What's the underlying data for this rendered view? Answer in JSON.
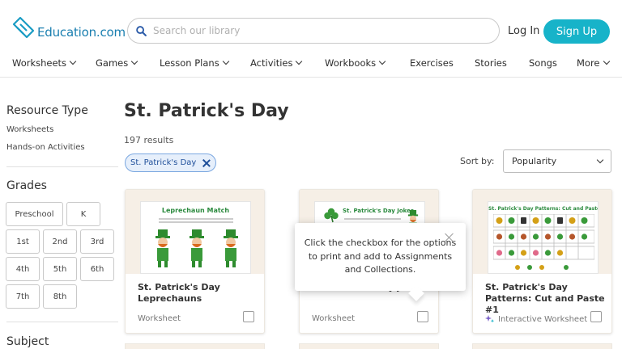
{
  "brand": {
    "name": "Education.com"
  },
  "search": {
    "placeholder": "Search our library"
  },
  "auth": {
    "login": "Log In",
    "signup": "Sign Up"
  },
  "nav": [
    {
      "label": "Worksheets",
      "dropdown": true
    },
    {
      "label": "Games",
      "dropdown": true
    },
    {
      "label": "Lesson Plans",
      "dropdown": true
    },
    {
      "label": "Activities",
      "dropdown": true
    },
    {
      "label": "Workbooks",
      "dropdown": true
    },
    {
      "label": "Exercises",
      "dropdown": false
    },
    {
      "label": "Stories",
      "dropdown": false
    },
    {
      "label": "Songs",
      "dropdown": false
    },
    {
      "label": "More",
      "dropdown": true
    }
  ],
  "sidebar": {
    "resource_type": {
      "heading": "Resource Type",
      "items": [
        "Worksheets",
        "Hands-on Activities"
      ]
    },
    "grades": {
      "heading": "Grades",
      "items": [
        "Preschool",
        "K",
        "1st",
        "2nd",
        "3rd",
        "4th",
        "5th",
        "6th",
        "7th",
        "8th"
      ]
    },
    "subject": {
      "heading": "Subject"
    }
  },
  "main": {
    "title": "St. Patrick's Day",
    "results": "197 results",
    "filter_chip": "St. Patrick's Day",
    "sort": {
      "label": "Sort by:",
      "value": "Popularity"
    }
  },
  "cards": [
    {
      "title": "St. Patrick's Day Leprechauns",
      "type": "Worksheet",
      "thumb_heading": "Leprechaun Match"
    },
    {
      "title": "St. Patrick's Day Jokes",
      "type": "Worksheet",
      "thumb_heading": "St. Patrick's Day Jokes"
    },
    {
      "title": "St. Patrick's Day Patterns: Cut and Paste #1",
      "type": "Interactive Worksheet",
      "thumb_heading": "St. Patrick's Day Patterns: Cut and Paste #1"
    }
  ],
  "tooltip": {
    "text": "Click the checkbox for the options to print and add to Assignments and Collections."
  },
  "colors": {
    "accent": "#17b3c9",
    "brand_blue": "#1a7fb0",
    "chip_bg": "#e6effb",
    "chip_border": "#7aa7e0",
    "card_thumb_bg": "#f6efe6",
    "leprechaun_green": "#3a9a3a"
  }
}
